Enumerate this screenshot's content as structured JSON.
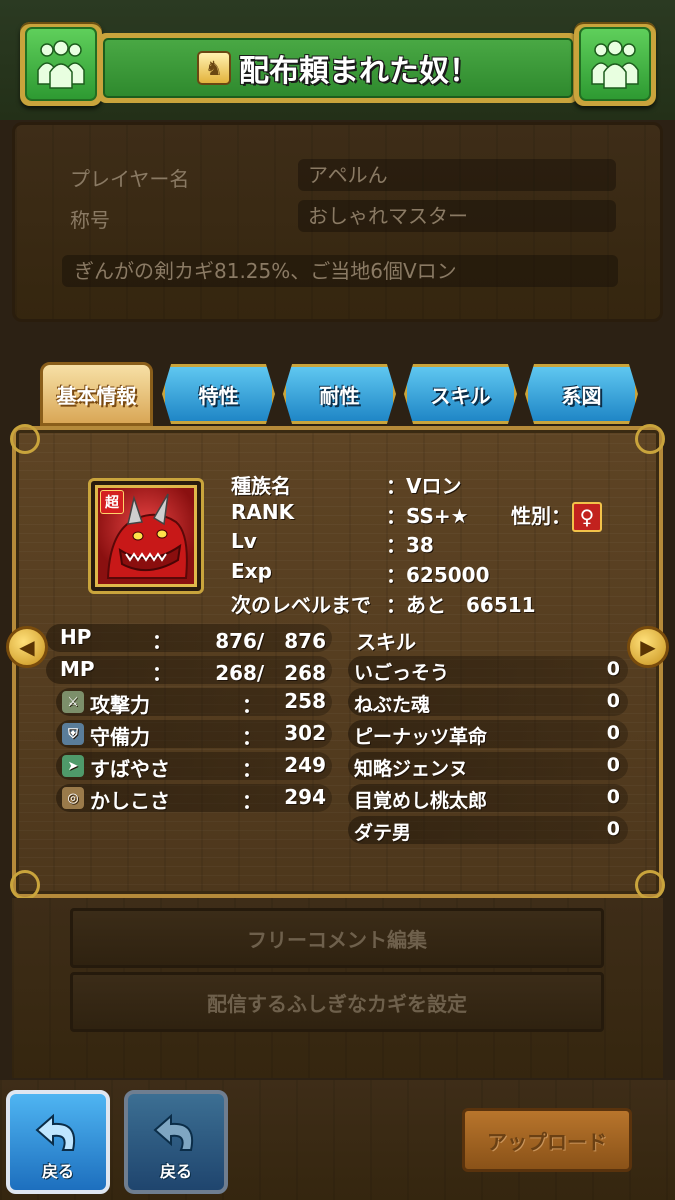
{
  "header": {
    "title": "配布頼まれた奴！",
    "left_icon": "group-icon",
    "right_icon": "group-icon",
    "title_icon": "key-horse-icon"
  },
  "profile": {
    "player_name_label": "プレイヤー名",
    "player_name": "アペルん",
    "title_label": "称号",
    "title_value": "おしゃれマスター",
    "comment": "ぎんがの剣カギ81.25%、ご当地6個Vロン"
  },
  "tabs": [
    {
      "label": "基本情報",
      "active": true
    },
    {
      "label": "特性",
      "active": false
    },
    {
      "label": "耐性",
      "active": false
    },
    {
      "label": "スキル",
      "active": false
    },
    {
      "label": "系図",
      "active": false
    }
  ],
  "monster": {
    "badge": "超",
    "species_label": "種族名",
    "species": "：Vロン",
    "rank_label": "RANK",
    "rank": "：SS+★",
    "gender_label": "性別：",
    "gender_symbol": "♀",
    "lv_label": "Lv",
    "lv": "：38",
    "exp_label": "Exp",
    "exp": "：625000",
    "next_label": "次のレベルまで",
    "next": "：あと　66511"
  },
  "stats": {
    "hp_label": "HP",
    "hp": "876/　876",
    "mp_label": "MP",
    "mp": "268/　268",
    "attack_label": "攻撃力",
    "attack": "258",
    "defense_label": "守備力",
    "defense": "302",
    "speed_label": "すばやさ",
    "speed": "249",
    "wisdom_label": "かしこさ",
    "wisdom": "294",
    "colon": "："
  },
  "skills": {
    "header": "スキル",
    "items": [
      {
        "name": "いごっそう",
        "points": "0"
      },
      {
        "name": "ねぶた魂",
        "points": "0"
      },
      {
        "name": "ピーナッツ革命",
        "points": "0"
      },
      {
        "name": "知略ジェンヌ",
        "points": "0"
      },
      {
        "name": "目覚めし桃太郎",
        "points": "0"
      },
      {
        "name": "ダテ男",
        "points": "0"
      }
    ]
  },
  "actions": {
    "free_comment": "フリーコメント編集",
    "set_key": "配信するふしぎなカギを設定",
    "back": "戻る",
    "upload": "アップロード"
  },
  "colors": {
    "wood": "#5e4424",
    "gold_border": "#c9a43c",
    "tab_blue": "#1f86c6",
    "header_green": "#2f8a2e",
    "back_blue": "#1d6fbe"
  }
}
